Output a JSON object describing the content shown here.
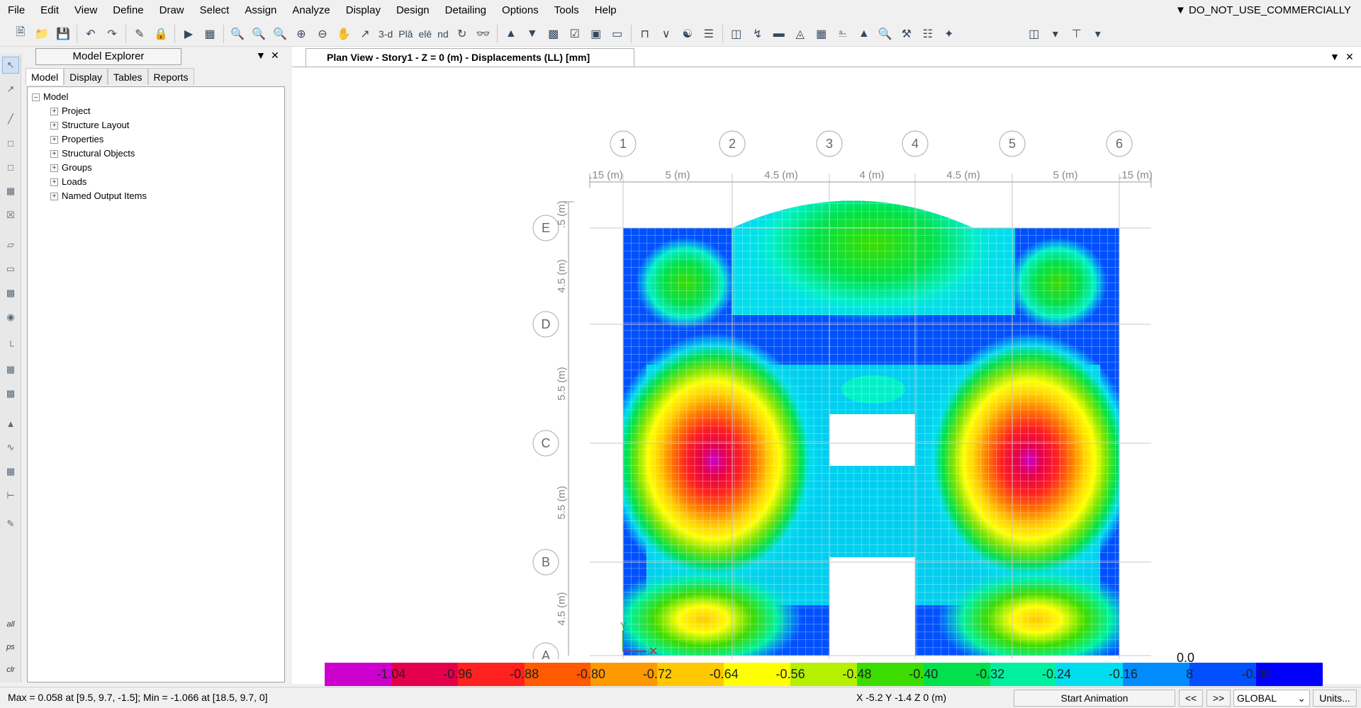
{
  "menu": [
    "File",
    "Edit",
    "View",
    "Define",
    "Draw",
    "Select",
    "Assign",
    "Analyze",
    "Display",
    "Design",
    "Detailing",
    "Options",
    "Tools",
    "Help"
  ],
  "license_label": "▼ DO_NOT_USE_COMMERCIALLY",
  "toolbar": {
    "view_3d": "3-d",
    "view_plan": "Plâ",
    "view_elev": "elē",
    "view_nd": "nd"
  },
  "left_strip": {
    "all": "all",
    "ps": "ps",
    "clr": "clr"
  },
  "explorer": {
    "title": "Model Explorer",
    "tabs": [
      "Model",
      "Display",
      "Tables",
      "Reports"
    ],
    "root": "Model",
    "items": [
      "Project",
      "Structure Layout",
      "Properties",
      "Structural Objects",
      "Groups",
      "Loads",
      "Named Output Items"
    ]
  },
  "plan": {
    "tab_title": "Plan View - Story1 - Z = 0 (m)   - Displacements (LL)  [mm]",
    "grid_x_labels": [
      "1",
      "2",
      "3",
      "4",
      "5",
      "6"
    ],
    "grid_y_labels": [
      "E",
      "D",
      "C",
      "B",
      "A"
    ],
    "x_dims": [
      ".15 (m)",
      "5 (m)",
      "4.5 (m)",
      "4 (m)",
      "4.5 (m)",
      "5 (m)",
      ".15 (m)"
    ],
    "y_dims": [
      ".5 (m)",
      "4.5 (m)",
      "5.5 (m)",
      "5.5 (m)",
      "4.5 (m)"
    ]
  },
  "legend": {
    "top_value": "0.0",
    "labels": [
      "-1.04",
      "-0.96",
      "-0.88",
      "-0.80",
      "-0.72",
      "-0.64",
      "-0.56",
      "-0.48",
      "-0.40",
      "-0.32",
      "-0.24",
      "-0.16",
      "8",
      "-0.00"
    ],
    "colors": [
      "#cc00cc",
      "#e4004c",
      "#ff2020",
      "#ff5a00",
      "#ff9900",
      "#ffc800",
      "#ffff00",
      "#b4f000",
      "#3cdc00",
      "#00e14b",
      "#00f0a0",
      "#00ddee",
      "#008cff",
      "#0050ff",
      "#0000ff"
    ]
  },
  "status": {
    "left": "Max = 0.058 at [9.5, 9.7, -1.5];  Min = -1.066 at [18.5, 9.7, 0]",
    "coords": "X -5.2  Y -1.4  Z 0 (m)",
    "start_animation": "Start Animation",
    "prev": "<<",
    "next": ">>",
    "coord_system": "GLOBAL",
    "units": "Units..."
  }
}
